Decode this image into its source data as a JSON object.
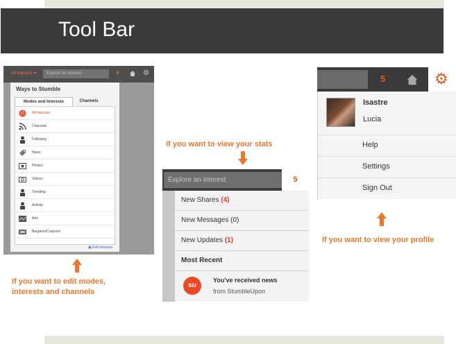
{
  "slide_title": "Tool Bar",
  "left_panel": {
    "interests_dropdown": "All Interests ▾",
    "search_placeholder": "Explore an interest",
    "count": "5",
    "heading": "Ways to Stumble",
    "tabs": [
      "Modes and Interests",
      "Channels"
    ],
    "items": [
      {
        "label": "All Interests",
        "icon": "globe-icon",
        "color": "#e8482a"
      },
      {
        "label": "Channels",
        "icon": "rss-icon",
        "color": "#444444"
      },
      {
        "label": "Following",
        "icon": "person-icon",
        "color": "#444444"
      },
      {
        "label": "News",
        "icon": "tag-icon",
        "color": "#444444"
      },
      {
        "label": "Photos",
        "icon": "photo-icon",
        "color": "#444444"
      },
      {
        "label": "Videos",
        "icon": "camera-icon",
        "color": "#444444"
      },
      {
        "label": "Trending",
        "icon": "person-icon",
        "color": "#444444"
      },
      {
        "label": "Activity",
        "icon": "person-icon",
        "color": "#444444"
      },
      {
        "label": "Arts",
        "icon": "arts-icon",
        "color": "#444444"
      },
      {
        "label": "Bargains/Coupons",
        "icon": "coupon-icon",
        "color": "#444444"
      }
    ],
    "edit_link": "▣ Edit Interests"
  },
  "middle_panel": {
    "search_placeholder": "Explore an interest",
    "count": "5",
    "rows": [
      {
        "label": "New Shares",
        "count": "(4)"
      },
      {
        "label": "New Messages",
        "count": "(0)"
      },
      {
        "label": "New Updates",
        "count": "(1)"
      }
    ],
    "section_title": "Most Recent",
    "news_title": "You've received news",
    "news_from": "from StumbleUpon"
  },
  "right_panel": {
    "count": "5",
    "user_name": "Isastre",
    "user_sub": "Lucia",
    "menu": [
      "Help",
      "Settings",
      "Sign Out"
    ]
  },
  "notes": {
    "stats": "If you want to view your stats",
    "profile": "If you want to view your profile",
    "edit_line1": "If  you want to edit modes,",
    "edit_line2": "interests and channels"
  },
  "colors": {
    "accent": "#e8782a",
    "dark": "#3a3a3a"
  }
}
